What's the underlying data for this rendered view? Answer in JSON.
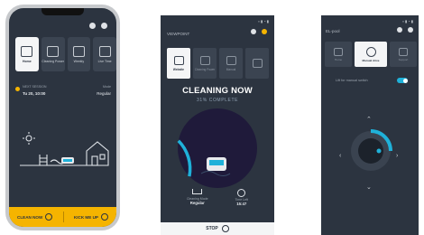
{
  "colors": {
    "app_bg": "#2c3440",
    "tab_bg": "#3b4451",
    "accent_yellow": "#f5b400",
    "accent_cyan": "#1fb1d9",
    "active_tab": "#f4f5f6"
  },
  "phone1": {
    "tabs": [
      {
        "label": "Home",
        "icon": "home-icon"
      },
      {
        "label": "Cleaning Power",
        "icon": "fan-icon"
      },
      {
        "label": "Weekly",
        "icon": "calendar-icon"
      },
      {
        "label": "Live Time",
        "icon": "clock-icon"
      }
    ],
    "schedule": {
      "title": "NEXT SESSION",
      "time": "Tu 20, 10:00",
      "mode_label": "Mode",
      "mode_value": "Regular"
    },
    "bottom_bar": {
      "left_label": "CLEAN NOW",
      "right_label": "KICK ME UP"
    }
  },
  "phone2": {
    "header": "VIEWPOINT",
    "tabs": [
      {
        "label": "Website",
        "icon": "home-icon"
      },
      {
        "label": "Cleaning Power",
        "icon": "fan-icon"
      },
      {
        "label": "Manual",
        "icon": "calendar-icon"
      }
    ],
    "status": "CLEANING NOW",
    "progress_text": "31% COMPLETE",
    "progress": 0.31,
    "mode": {
      "label": "Cleaning Mode",
      "value": "Regular"
    },
    "time": {
      "label": "Time Left",
      "value": "15:47"
    },
    "stop_label": "STOP"
  },
  "phone3": {
    "header": "EL-pool",
    "tabs": [
      {
        "label": "Home",
        "icon": "calendar-icon"
      },
      {
        "label": "Manual drive",
        "icon": "joystick-icon"
      },
      {
        "label": "Support",
        "icon": "info-icon"
      }
    ],
    "toggle_label": "Lift for manual switch",
    "toggle_on": true
  }
}
